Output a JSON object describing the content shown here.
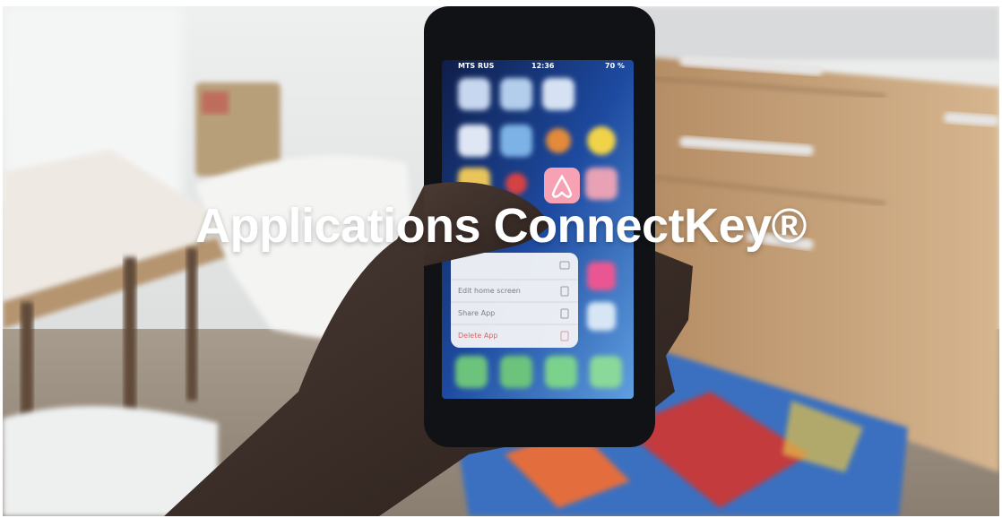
{
  "hero": {
    "title": "Applications ConnectKey®"
  },
  "phone": {
    "carrier": "MTS RUS",
    "time": "12:36",
    "battery": "70 %",
    "menu_items": [
      "Edit home screen",
      "Share App",
      "Delete App"
    ]
  },
  "colors": {
    "title": "#ffffff",
    "airbnb_icon": "#f7a1b5",
    "kitchen_wood": "#c9a47f",
    "rug_blue": "#3a6fc0",
    "rug_red": "#c33a3c"
  }
}
